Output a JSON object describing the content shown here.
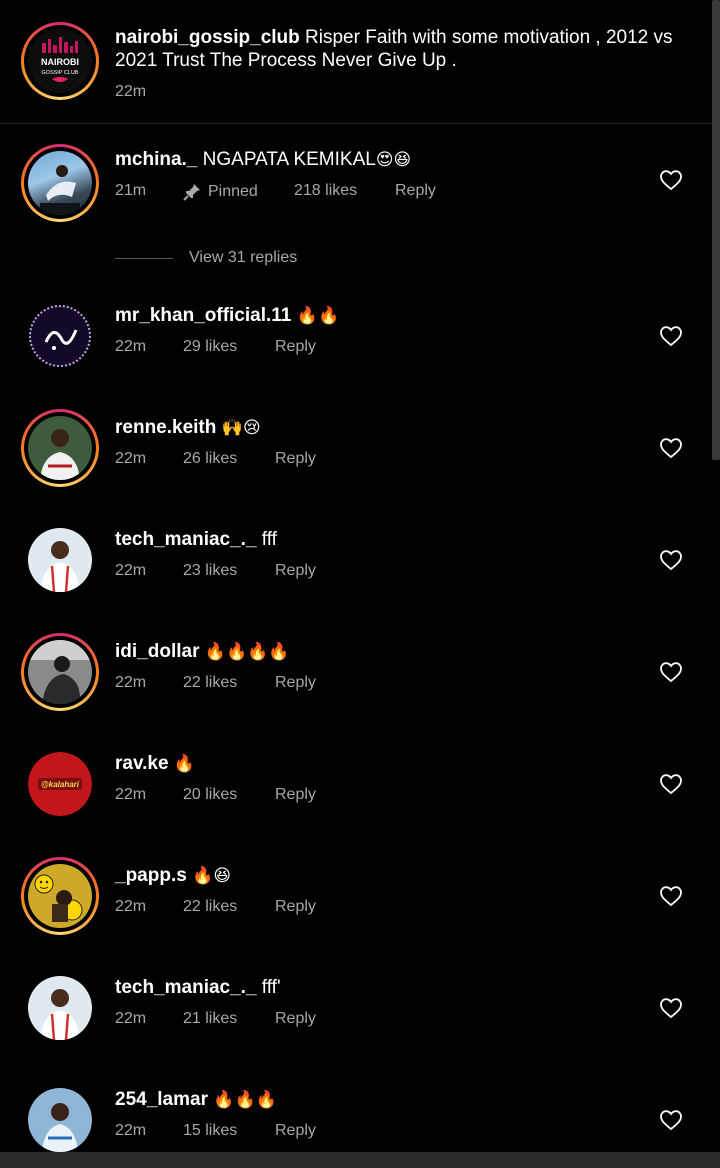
{
  "caption": {
    "username": "nairobi_gossip_club",
    "text_line1": "Risper Faith with some motivation , 2012 vs",
    "text_line2": "2021  Trust The Process Never Give Up .",
    "time": "22m",
    "logo_line1": "NAIROBI",
    "logo_line2": "GOSSIP CLUB"
  },
  "pinned_comment": {
    "username": "mchina._",
    "text": "NGAPATA KEMIKAL",
    "emojis": "😍😆",
    "time": "21m",
    "pinned_label": "Pinned",
    "likes": "218 likes",
    "reply_label": "Reply",
    "view_replies": "View 31 replies"
  },
  "comments": [
    {
      "username": "mr_khan_official.11",
      "text": "",
      "emojis": "🔥🔥",
      "time": "22m",
      "likes": "29 likes",
      "reply": "Reply"
    },
    {
      "username": "renne.keith",
      "text": "",
      "emojis": "🙌😢",
      "time": "22m",
      "likes": "26 likes",
      "reply": "Reply"
    },
    {
      "username": "tech_maniac_._",
      "text": "fff",
      "emojis": "",
      "time": "22m",
      "likes": "23 likes",
      "reply": "Reply"
    },
    {
      "username": "idi_dollar",
      "text": "",
      "emojis": "🔥🔥🔥🔥",
      "time": "22m",
      "likes": "22 likes",
      "reply": "Reply"
    },
    {
      "username": "rav.ke",
      "text": "",
      "emojis": "🔥",
      "time": "22m",
      "likes": "20 likes",
      "reply": "Reply"
    },
    {
      "username": "_papp.s",
      "text": "",
      "emojis": "🔥😆",
      "time": "22m",
      "likes": "22 likes",
      "reply": "Reply"
    },
    {
      "username": "tech_maniac_._",
      "text": "fff'",
      "emojis": "",
      "time": "22m",
      "likes": "21 likes",
      "reply": "Reply"
    },
    {
      "username": "254_lamar",
      "text": "",
      "emojis": "🔥🔥🔥",
      "time": "22m",
      "likes": "15 likes",
      "reply": "Reply"
    }
  ],
  "rav_avatar_text": "@kalahari",
  "icons": {
    "heart": "heart-outline-icon",
    "pin": "pin-icon"
  },
  "colors": {
    "background": "#000000",
    "secondary_text": "#a8a8a8",
    "story_ring_start": "#d62976",
    "story_ring_end": "#feda75"
  }
}
